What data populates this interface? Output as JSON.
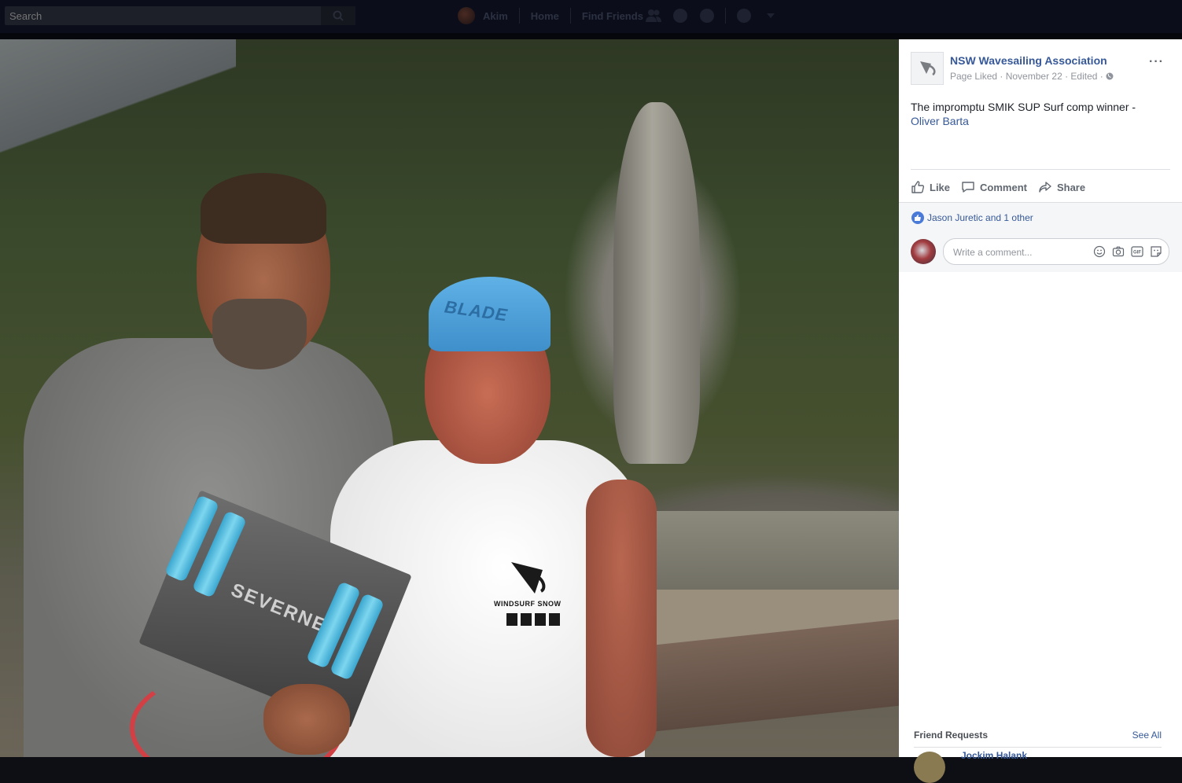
{
  "topbar": {
    "search_placeholder": "Search",
    "profile_name": "Akim",
    "home": "Home",
    "find_friends": "Find Friends",
    "icons": [
      "friend-requests-icon",
      "messages-icon",
      "notifications-icon",
      "help-icon",
      "account-menu-icon"
    ]
  },
  "photo": {
    "cap_text": "BLADE",
    "package_text": "SEVERNE",
    "tshirt_text": "WINDSURF SNOW"
  },
  "post": {
    "page_name": "NSW Wavesailing Association",
    "meta": "Page Liked · November 22 · Edited ·",
    "text": "The impromptu SMIK SUP Surf comp winner -",
    "mention": "Oliver Barta",
    "actions": {
      "like": "Like",
      "comment": "Comment",
      "share": "Share"
    },
    "likes_text": "Jason Juretic and 1 other",
    "comment_placeholder": "Write a comment..."
  },
  "friend_requests": {
    "title": "Friend Requests",
    "see_all": "See All",
    "first_name": "Jockim Halank"
  },
  "colors": {
    "link_blue": "#365899",
    "top_bar": "#0b0e1a",
    "like_blue": "#4a7bd8"
  }
}
